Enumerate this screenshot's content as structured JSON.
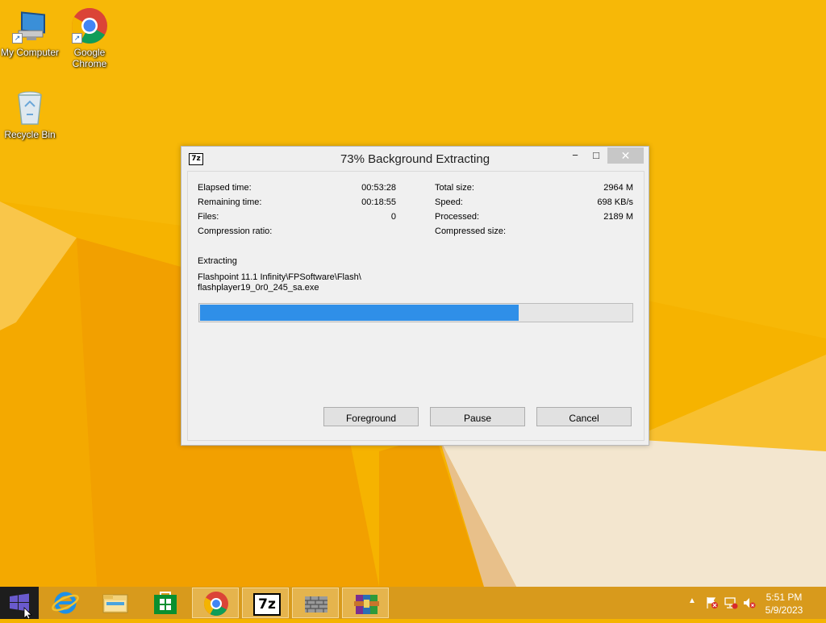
{
  "desktop": {
    "icons": [
      {
        "label": "My Computer",
        "icon": "computer-icon"
      },
      {
        "label": "Google Chrome",
        "icon": "chrome-icon"
      },
      {
        "label": "Recycle Bin",
        "icon": "recycle-bin-icon"
      }
    ]
  },
  "dialog": {
    "title": "73% Background Extracting",
    "app_icon_text": "7z",
    "controls": {
      "minimize": "−",
      "maximize": "□",
      "close": "✕"
    },
    "stats_left": [
      {
        "label": "Elapsed time:",
        "value": "00:53:28"
      },
      {
        "label": "Remaining time:",
        "value": "00:18:55"
      },
      {
        "label": "Files:",
        "value": "0"
      },
      {
        "label": "Compression ratio:",
        "value": ""
      }
    ],
    "stats_right": [
      {
        "label": "Total size:",
        "value": "2964 M"
      },
      {
        "label": "Speed:",
        "value": "698 KB/s"
      },
      {
        "label": "Processed:",
        "value": "2189 M"
      },
      {
        "label": "Compressed size:",
        "value": ""
      }
    ],
    "operation": "Extracting",
    "path_line1": "Flashpoint 11.1 Infinity\\FPSoftware\\Flash\\",
    "path_line2": "flashplayer19_0r0_245_sa.exe",
    "progress_fraction": 0.738,
    "buttons": {
      "foreground": "Foreground",
      "pause": "Pause",
      "cancel": "Cancel"
    }
  },
  "taskbar": {
    "items": [
      {
        "name": "internet-explorer-icon",
        "open": false
      },
      {
        "name": "file-explorer-icon",
        "open": false
      },
      {
        "name": "store-icon",
        "open": false
      },
      {
        "name": "chrome-icon",
        "open": true
      },
      {
        "name": "7zip-icon",
        "open": true,
        "text": "7z"
      },
      {
        "name": "wall-app-icon",
        "open": true
      },
      {
        "name": "winrar-icon",
        "open": true
      }
    ],
    "clock_time": "5:51 PM",
    "clock_date": "5/9/2023"
  },
  "colors": {
    "wallpaper": "#f5b400",
    "progress": "#2f8fe8",
    "start": "#1d1d1d"
  }
}
